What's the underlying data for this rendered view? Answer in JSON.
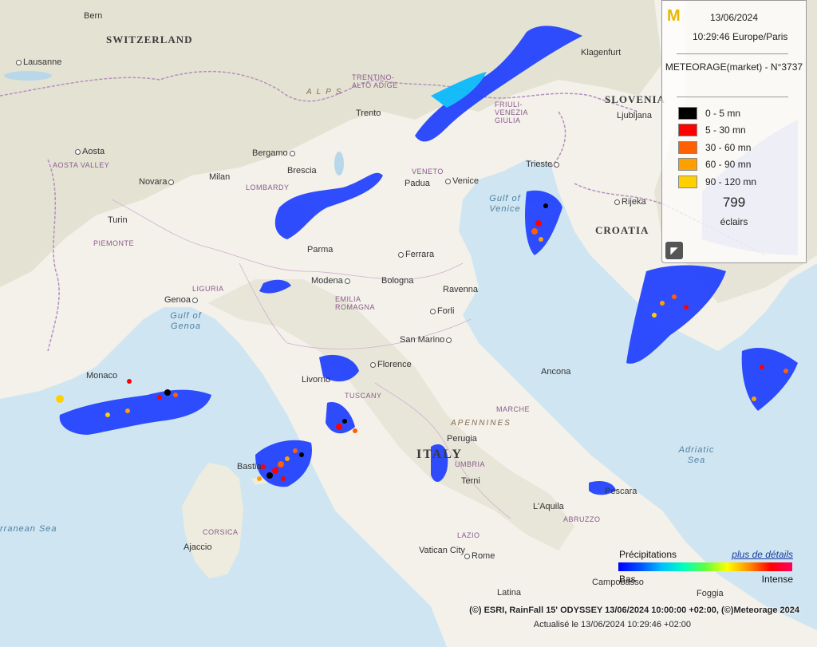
{
  "legend": {
    "date": "13/06/2024",
    "time": "10:29:46 Europe/Paris",
    "network": "METEORAGE(market) - N°3737",
    "items": [
      {
        "label": "0 - 5 mn",
        "color": "#000000"
      },
      {
        "label": "5 - 30 mn",
        "color": "#ff0000"
      },
      {
        "label": "30 - 60 mn",
        "color": "#ff6000"
      },
      {
        "label": "60 - 90 mn",
        "color": "#ffa000"
      },
      {
        "label": "90 - 120 mn",
        "color": "#ffd000"
      }
    ],
    "count": "799",
    "count_label": "éclairs",
    "collapse_icon": "arrow-icon"
  },
  "precipitation": {
    "title": "Précipitations",
    "details_link": "plus de détails",
    "low": "Bas",
    "high": "Intense"
  },
  "credits": "(©) ESRI, RainFall 15' ODYSSEY 13/06/2024 10:00:00 +02:00, (©)Meteorage 2024",
  "updated": "Actualisé le 13/06/2024 10:29:46 +02:00",
  "map": {
    "countries": [
      "SWITZERLAND",
      "SLOVENIA",
      "CROATIA",
      "ITALY"
    ],
    "cities": [
      "Bern",
      "Lausanne",
      "Klagenfurt",
      "Ljubljana",
      "Trento",
      "Bergamo",
      "Aosta",
      "Milan",
      "Brescia",
      "Novara",
      "Padua",
      "Venice",
      "Trieste",
      "Rijeka",
      "Turin",
      "Parma",
      "Ferrara",
      "Modena",
      "Bologna",
      "Ravenna",
      "Genoa",
      "Forli",
      "San Marino",
      "Monaco",
      "Livorno",
      "Florence",
      "Ancona",
      "Perugia",
      "Bastia",
      "Terni",
      "L'Aquila",
      "Ajaccio",
      "Vatican City",
      "Rome",
      "Pescara",
      "Latina",
      "Foggia",
      "Campobasso"
    ],
    "regions": [
      "AOSTA VALLEY",
      "LOMBARDY",
      "PIEMONTE",
      "LIGURIA",
      "VENETO",
      "TRENTINO-ALTO ADIGE",
      "FRIULI-VENEZIA GIULIA",
      "EMILIA ROMAGNA",
      "TUSCANY",
      "MARCHE",
      "UMBRIA",
      "ABRUZZO",
      "LAZIO",
      "CORSICA"
    ],
    "seas": [
      "Gulf of Genoa",
      "Gulf of Venice",
      "Adriatic Sea",
      "rranean Sea"
    ],
    "mountains": [
      "ALPS",
      "APENNINES"
    ]
  }
}
